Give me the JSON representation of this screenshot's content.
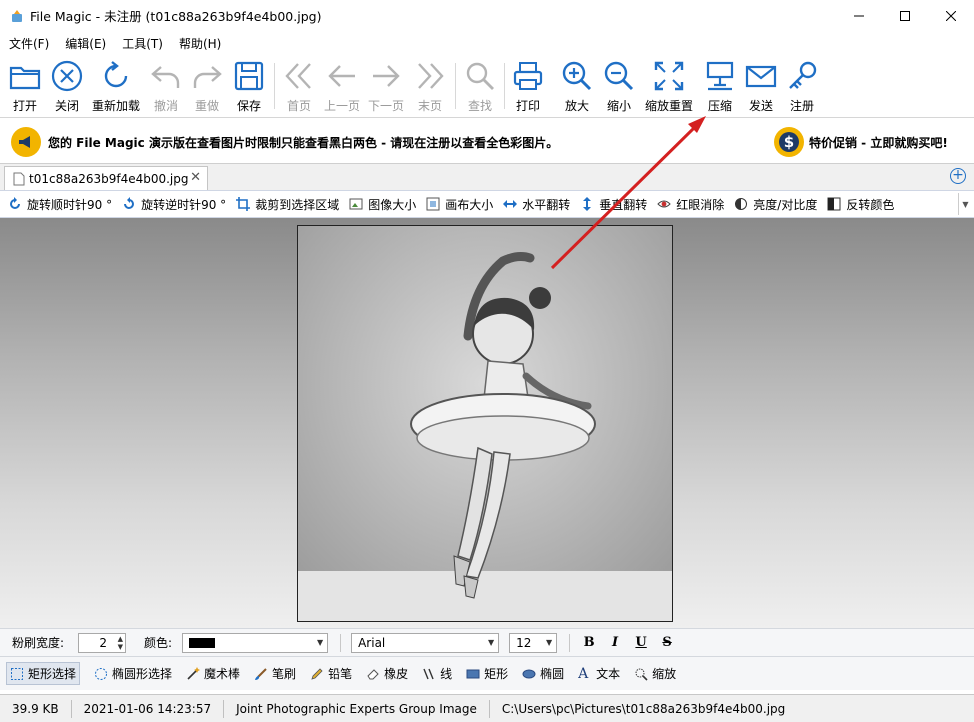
{
  "window": {
    "title": "File Magic - 未注册 (t01c88a263b9f4e4b00.jpg)"
  },
  "menu": [
    "文件(F)",
    "编辑(E)",
    "工具(T)",
    "帮助(H)"
  ],
  "toolbar": {
    "open": "打开",
    "close": "关闭",
    "reload": "重新加载",
    "undo": "撤消",
    "redo": "重做",
    "save": "保存",
    "first": "首页",
    "prev": "上一页",
    "next": "下一页",
    "last": "末页",
    "find": "查找",
    "print": "打印",
    "zoom_in": "放大",
    "zoom_out": "缩小",
    "zoom_reset": "缩放重置",
    "compress": "压缩",
    "send": "发送",
    "register": "注册"
  },
  "banner": {
    "message": "您的 File Magic 演示版在查看图片时限制只能查看黑白两色 - 请现在注册以查看全色彩图片。",
    "promo": "特价促销 - 立即就购买吧!"
  },
  "tab": {
    "title": "t01c88a263b9f4e4b00.jpg",
    "close": "✕"
  },
  "edit_toolbar": [
    "旋转顺时针90 °",
    "旋转逆时针90 °",
    "裁剪到选择区域",
    "图像大小",
    "画布大小",
    "水平翻转",
    "垂直翻转",
    "红眼消除",
    "亮度/对比度",
    "反转颜色"
  ],
  "props_bar": {
    "brush_width_label": "粉刷宽度:",
    "brush_width": "2",
    "color_label": "颜色:",
    "color": "#000000",
    "font": "Arial",
    "font_size": "12",
    "bold": "B",
    "italic": "I",
    "underline": "U",
    "strike": "S"
  },
  "tools_bar": [
    "矩形选择",
    "椭圆形选择",
    "魔术棒",
    "笔刷",
    "铅笔",
    "橡皮",
    "线",
    "矩形",
    "椭圆",
    "文本",
    "缩放"
  ],
  "status": {
    "size": "39.9 KB",
    "datetime": "2021-01-06 14:23:57",
    "format": "Joint Photographic Experts Group Image",
    "path": "C:\\Users\\pc\\Pictures\\t01c88a263b9f4e4b00.jpg"
  },
  "colors": {
    "icon_blue": "#1f6fc5",
    "disabled_gray": "#b4b4b4",
    "arrow_red": "#d42020"
  }
}
